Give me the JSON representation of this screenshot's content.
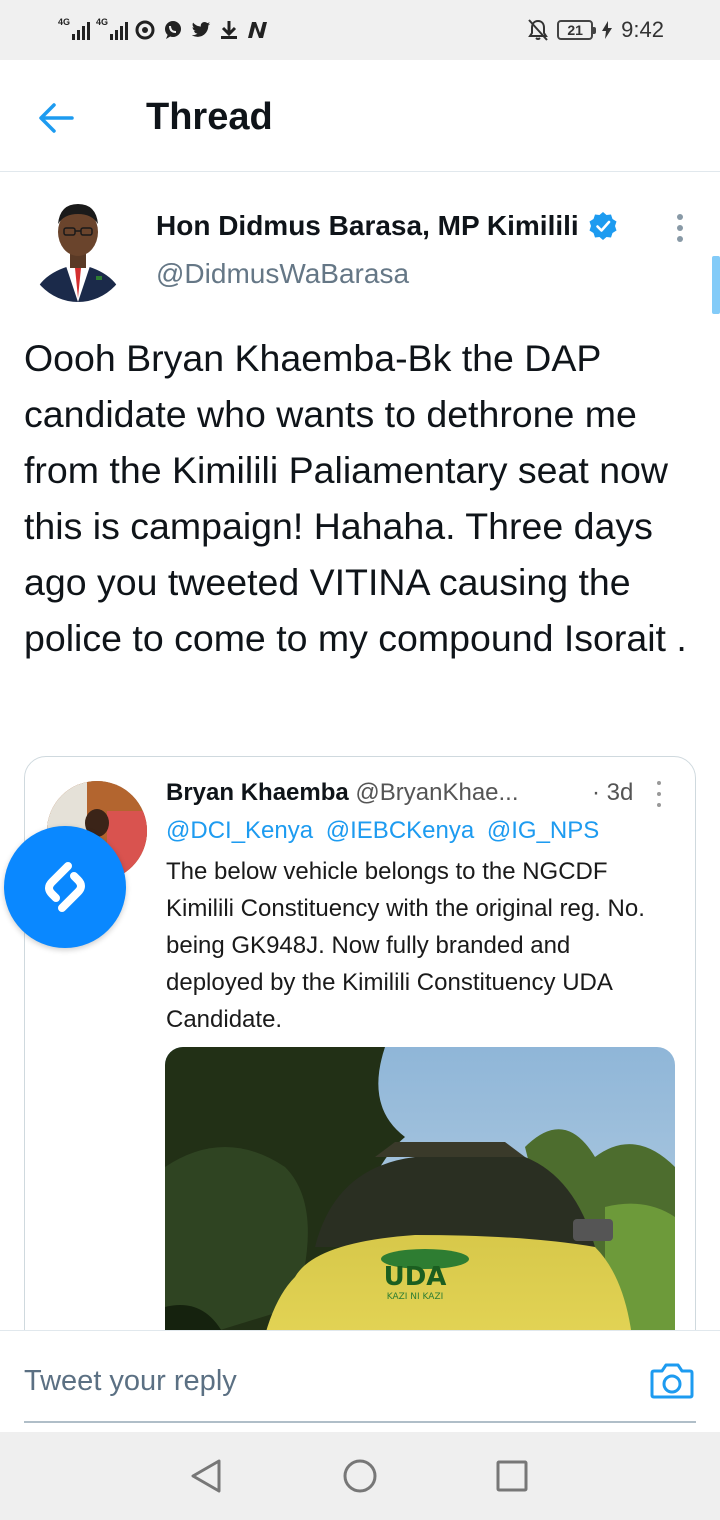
{
  "status_bar": {
    "network_1": "4G",
    "network_2": "4G",
    "battery_level": "21",
    "time": "9:42",
    "icons": [
      "signal-icon",
      "signal-icon",
      "opera-icon",
      "whatsapp-icon",
      "twitter-icon",
      "download-icon",
      "n-app-icon",
      "mute-icon",
      "battery-icon",
      "charging-icon"
    ]
  },
  "header": {
    "title": "Thread"
  },
  "tweet": {
    "author_name": "Hon Didmus Barasa, MP Kimilili",
    "author_handle": "@DidmusWaBarasa",
    "verified": true,
    "text": "Oooh Bryan Khaemba-Bk the DAP candidate who wants to dethrone me from the Kimilili Paliamentary seat now this is campaign! Hahaha.  Three days ago you tweeted VITINA causing the police to come to my compound Isorait ."
  },
  "quoted_tweet": {
    "author_name": "Bryan Khaemba",
    "author_handle": "@BryanKhae...",
    "time": "· 3d",
    "mentions": [
      "@DCI_Kenya",
      "@IEBCKenya",
      "@IG_NPS"
    ],
    "body": "The below vehicle belongs to the NGCDF Kimilili Constituency with the original reg. No. being GK948J. Now fully branded and deployed by the Kimilili Constituency UDA Candidate.",
    "image_text": "UDA",
    "image_subtext": "KAZI NI KAZI"
  },
  "reply": {
    "placeholder": "Tweet your reply"
  },
  "colors": {
    "accent": "#1d9bf0",
    "handle_gray": "#657786",
    "shazam_blue": "#0a88ff"
  }
}
